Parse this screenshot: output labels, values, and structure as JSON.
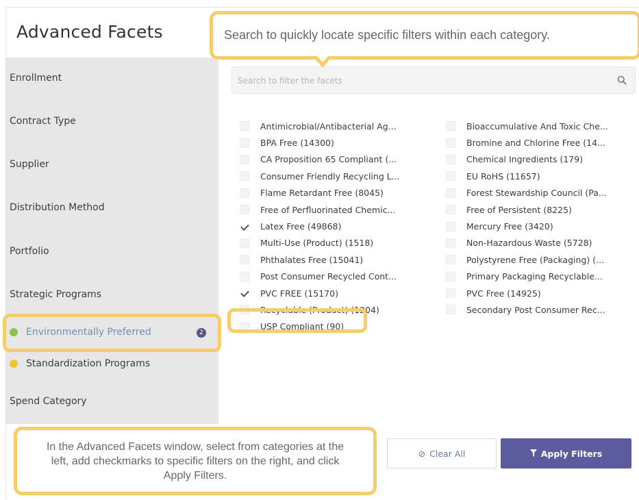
{
  "title": "Advanced Facets",
  "sidebar": {
    "items": [
      {
        "label": "Enrollment"
      },
      {
        "label": "Contract Type"
      },
      {
        "label": "Supplier"
      },
      {
        "label": "Distribution Method"
      },
      {
        "label": "Portfolio"
      },
      {
        "label": "Strategic Programs"
      },
      {
        "label": "Environmentally Preferred",
        "badge": "2"
      },
      {
        "label": "Standardization Programs"
      },
      {
        "label": "Spend Category"
      }
    ]
  },
  "search": {
    "placeholder": "Search to filter the facets",
    "value": ""
  },
  "facets": {
    "col1": [
      {
        "label": "Antimicrobial/Antibacterial Ag...",
        "checked": false
      },
      {
        "label": "BPA Free (14300)",
        "checked": false
      },
      {
        "label": "CA Proposition 65 Compliant (...",
        "checked": false
      },
      {
        "label": "Consumer Friendly Recycling L...",
        "checked": false
      },
      {
        "label": "Flame Retardant Free (8045)",
        "checked": false
      },
      {
        "label": "Free of Perfluorinated Chemic...",
        "checked": false
      },
      {
        "label": "Latex Free (49868)",
        "checked": true
      },
      {
        "label": "Multi-Use (Product) (1518)",
        "checked": false
      },
      {
        "label": "Phthalates Free (15041)",
        "checked": false
      },
      {
        "label": "Post Consumer Recycled Cont...",
        "checked": false
      },
      {
        "label": "PVC FREE (15170)",
        "checked": true
      },
      {
        "label": "Recyclable (Product) (1204)",
        "checked": false
      },
      {
        "label": "USP Compliant (90)",
        "checked": false
      }
    ],
    "col2": [
      {
        "label": "Bioaccumulative And Toxic Che...",
        "checked": false
      },
      {
        "label": "Bromine and Chlorine Free (14...",
        "checked": false
      },
      {
        "label": "Chemical Ingredients (179)",
        "checked": false
      },
      {
        "label": "EU RoHS (11657)",
        "checked": false
      },
      {
        "label": "Forest Stewardship Council (Pa...",
        "checked": false
      },
      {
        "label": "Free of Persistent (8225)",
        "checked": false
      },
      {
        "label": "Mercury Free (3420)",
        "checked": false
      },
      {
        "label": "Non-Hazardous Waste (5728)",
        "checked": false
      },
      {
        "label": "Polystyrene Free (Packaging) (...",
        "checked": false
      },
      {
        "label": "Primary Packaging Recyclable...",
        "checked": false
      },
      {
        "label": "PVC Free (14925)",
        "checked": false
      },
      {
        "label": "Secondary Post Consumer Rec...",
        "checked": false
      }
    ]
  },
  "buttons": {
    "clear_label": "Clear All",
    "apply_label": "Apply Filters"
  },
  "callouts": {
    "search_tip": "Search to quickly locate specific filters within each category.",
    "instructions": "In the Advanced Facets window, select from categories at the left, add checkmarks to specific filters on the right, and click Apply Filters."
  },
  "colors": {
    "accent": "#5b5b9d",
    "callout_border": "#f5cd6b",
    "sidebar_bg": "#e7e7e7",
    "env_dot": "#8bc34a",
    "std_dot": "#f2c230"
  }
}
